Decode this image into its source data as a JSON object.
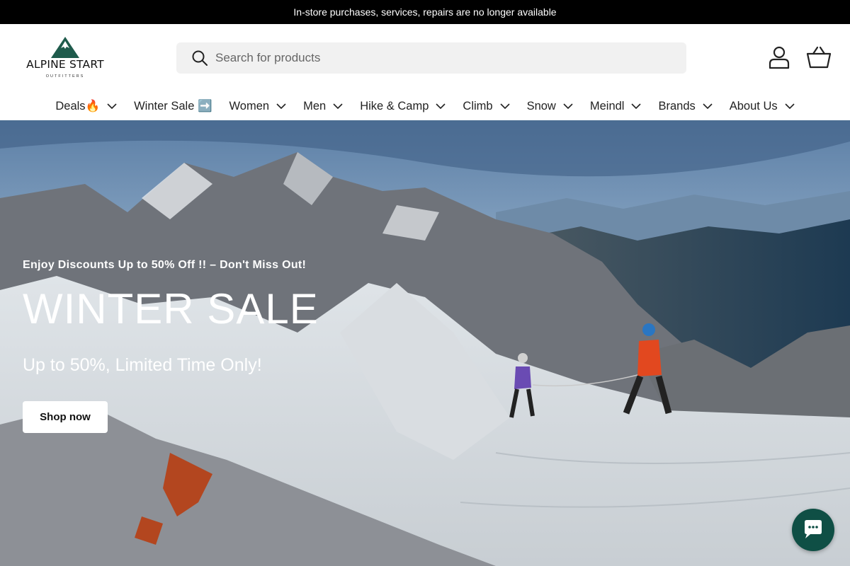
{
  "announcement": {
    "text": "In-store purchases, services, repairs are no longer available"
  },
  "header": {
    "logo": {
      "name": "ALPINE START",
      "subtitle": "OUTFITTERS",
      "brand_color": "#1f5b4c"
    },
    "search": {
      "placeholder": "Search for products",
      "value": ""
    },
    "icons": {
      "search": "search-icon",
      "account": "account-icon",
      "cart": "cart-icon"
    }
  },
  "nav": {
    "items": [
      {
        "label": "Deals🔥",
        "dropdown": true
      },
      {
        "label": "Winter Sale ➡️",
        "dropdown": false
      },
      {
        "label": "Women",
        "dropdown": true
      },
      {
        "label": "Men",
        "dropdown": true
      },
      {
        "label": "Hike & Camp",
        "dropdown": true
      },
      {
        "label": "Climb",
        "dropdown": true
      },
      {
        "label": "Snow",
        "dropdown": true
      },
      {
        "label": "Meindl",
        "dropdown": true
      },
      {
        "label": "Brands",
        "dropdown": true
      },
      {
        "label": "About Us",
        "dropdown": true
      }
    ]
  },
  "hero": {
    "kicker": "Enjoy Discounts Up to 50% Off !! – Don't Miss Out!",
    "title": "WINTER SALE",
    "subtitle": "Up to 50%, Limited Time Only!",
    "button_label": "Shop now"
  },
  "chat": {
    "icon": "chat-icon",
    "color": "#0f4f45"
  }
}
